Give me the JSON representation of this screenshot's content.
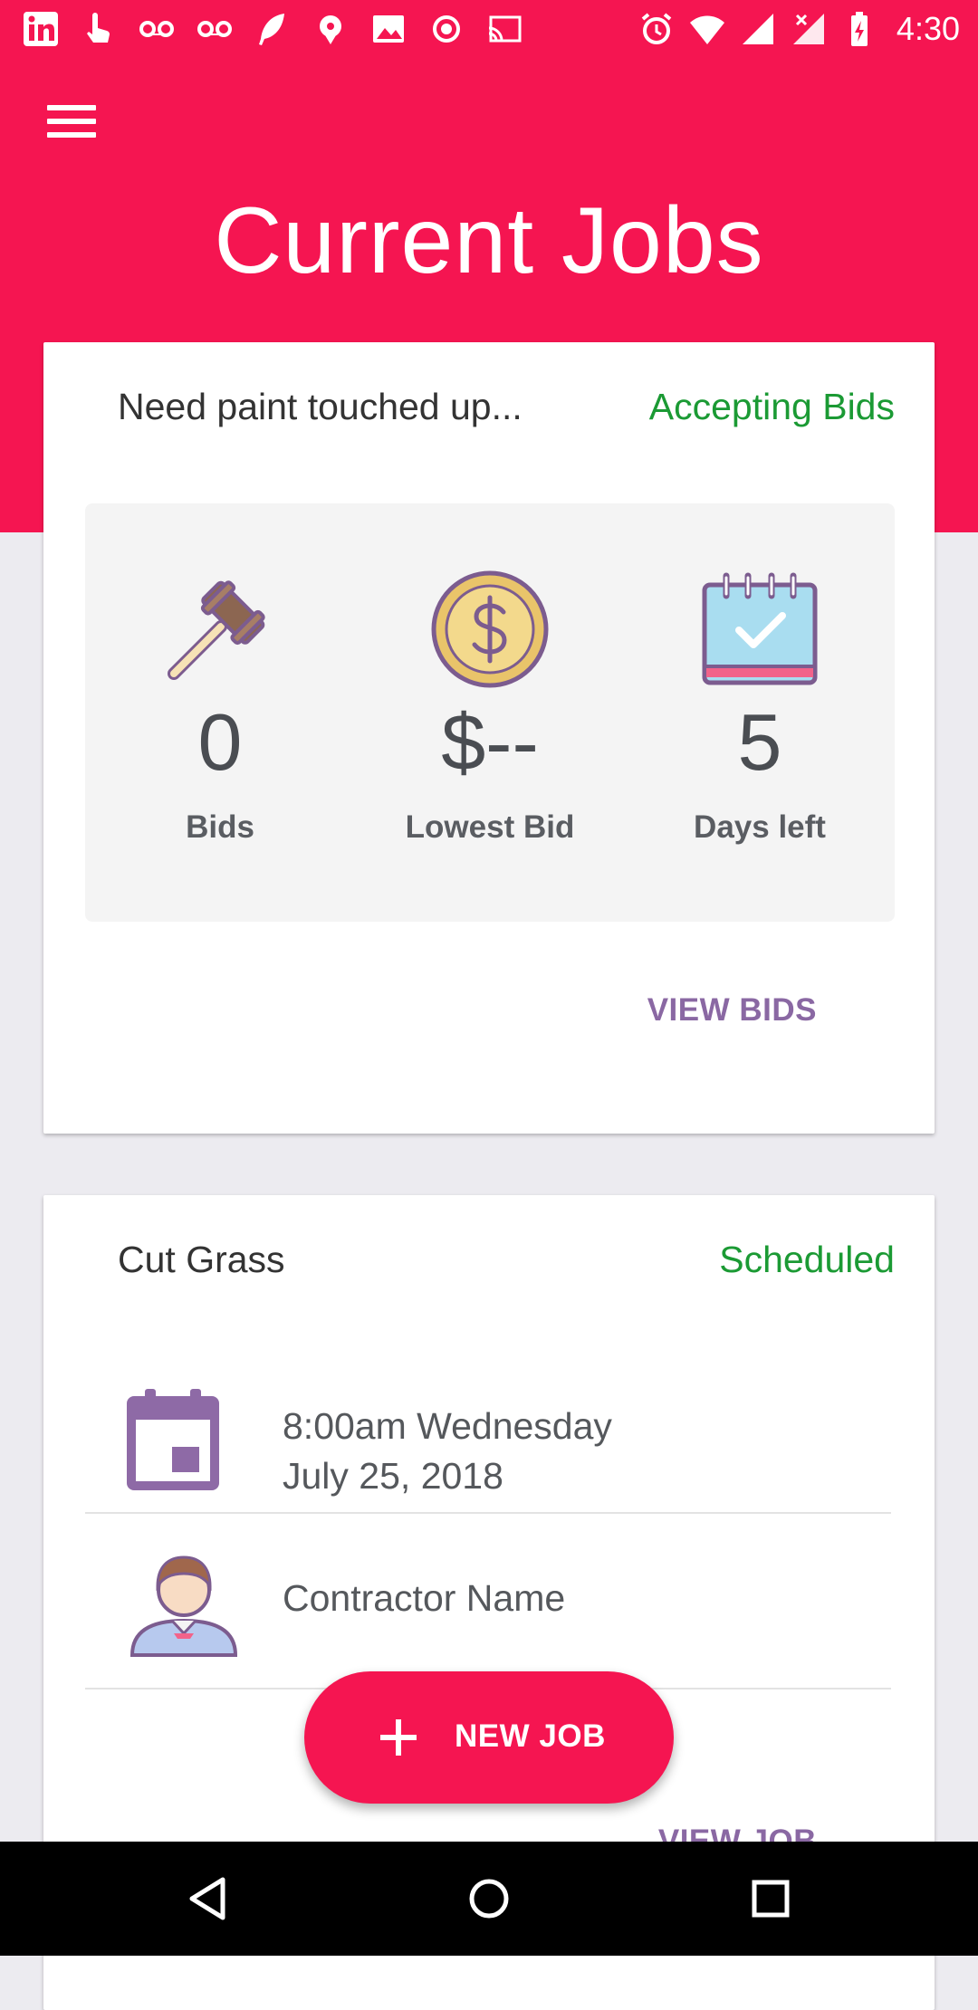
{
  "status_bar": {
    "time": "4:30",
    "left_icons": [
      "linkedin-icon",
      "touch-icon",
      "voicemail-icon",
      "voicemail-icon",
      "feather-icon",
      "app-icon",
      "image-icon",
      "record-icon",
      "cast-icon"
    ],
    "right_icons": [
      "alarm-icon",
      "wifi-icon",
      "signal-icon",
      "signal-off-icon",
      "battery-charging-icon"
    ]
  },
  "colors": {
    "primary": "#F51551",
    "accent_purple": "#8A68A3",
    "status_green": "#1B9A34",
    "background": "#ECEBF0"
  },
  "header": {
    "title": "Current Jobs"
  },
  "jobs": [
    {
      "title": "Need paint touched up...",
      "status": "Accepting Bids",
      "stats": [
        {
          "icon": "gavel-icon",
          "value": "0",
          "label": "Bids"
        },
        {
          "icon": "coin-icon",
          "value": "$--",
          "label": "Lowest Bid"
        },
        {
          "icon": "calendar-check-icon",
          "value": "5",
          "label": "Days left"
        }
      ],
      "action": "VIEW BIDS"
    },
    {
      "title": "Cut Grass",
      "status": "Scheduled",
      "schedule": {
        "line1": "8:00am Wednesday",
        "line2": "July 25, 2018"
      },
      "contractor": "Contractor Name",
      "action": "VIEW JOB"
    }
  ],
  "fab": {
    "label": "NEW JOB"
  },
  "nav": [
    "back-icon",
    "home-icon",
    "recents-icon"
  ]
}
